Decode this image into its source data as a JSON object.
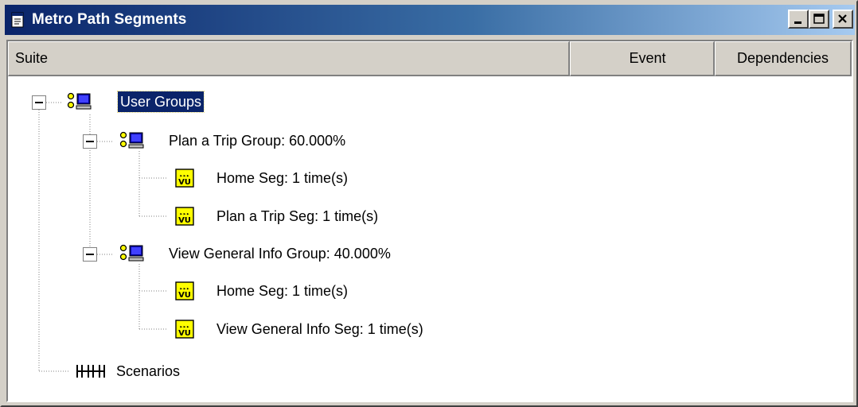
{
  "window": {
    "title": "Metro Path Segments"
  },
  "columns": {
    "suite": "Suite",
    "event": "Event",
    "dependencies": "Dependencies"
  },
  "tree": {
    "root": {
      "label": "User Groups",
      "icon": "user-groups-icon",
      "groups": [
        {
          "label": "Plan a Trip Group: 60.000%",
          "icon": "user-group-icon",
          "segments": [
            {
              "label": "Home Seg: 1 time(s)",
              "icon": "vu-script-icon"
            },
            {
              "label": "Plan a Trip Seg: 1 time(s)",
              "icon": "vu-script-icon"
            }
          ]
        },
        {
          "label": "View General Info Group: 40.000%",
          "icon": "user-group-icon",
          "segments": [
            {
              "label": "Home Seg: 1 time(s)",
              "icon": "vu-script-icon"
            },
            {
              "label": "View General Info Seg: 1 time(s)",
              "icon": "vu-script-icon"
            }
          ]
        }
      ]
    },
    "scenarios": {
      "label": "Scenarios",
      "icon": "scenarios-icon"
    }
  },
  "colors": {
    "title_gradient_start": "#0a246a",
    "title_gradient_end": "#a6caf0",
    "selection": "#0a246a",
    "chrome": "#d4d0c8"
  }
}
